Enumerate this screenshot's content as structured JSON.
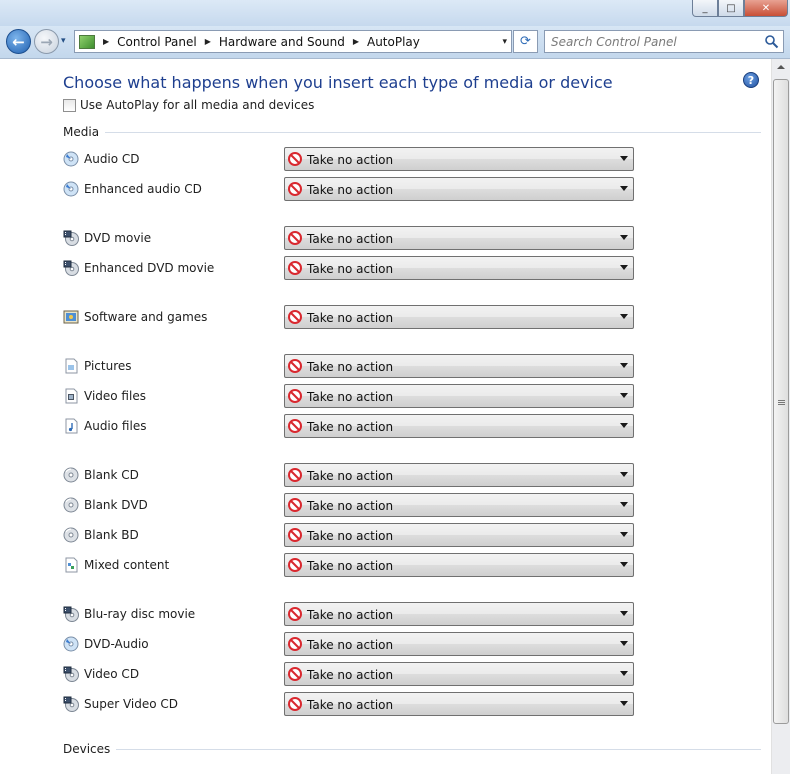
{
  "window": {
    "minimize_glyph": "_",
    "maximize_glyph": "□",
    "close_glyph": "✕"
  },
  "nav": {
    "back_glyph": "←",
    "forward_glyph": "→",
    "recent_glyph": "▾",
    "breadcrumbs": [
      "Control Panel",
      "Hardware and Sound",
      "AutoPlay"
    ],
    "dropdown_glyph": "▾",
    "refresh_glyph": "⟳",
    "search_placeholder": "Search Control Panel"
  },
  "page": {
    "title": "Choose what happens when you insert each type of media or device",
    "help_glyph": "?",
    "use_autoplay_label": "Use AutoPlay for all media and devices",
    "use_autoplay_checked": false,
    "media_section": "Media",
    "devices_section": "Devices"
  },
  "media": [
    {
      "label": "Audio CD",
      "icon": "audio-cd-icon",
      "action": "Take no action"
    },
    {
      "label": "Enhanced audio CD",
      "icon": "audio-cd-icon",
      "action": "Take no action"
    },
    {
      "label": "DVD movie",
      "icon": "dvd-movie-icon",
      "action": "Take no action"
    },
    {
      "label": "Enhanced DVD movie",
      "icon": "dvd-movie-icon",
      "action": "Take no action"
    },
    {
      "label": "Software and games",
      "icon": "software-icon",
      "action": "Take no action"
    },
    {
      "label": "Pictures",
      "icon": "pictures-icon",
      "action": "Take no action"
    },
    {
      "label": "Video files",
      "icon": "video-files-icon",
      "action": "Take no action"
    },
    {
      "label": "Audio files",
      "icon": "audio-files-icon",
      "action": "Take no action"
    },
    {
      "label": "Blank CD",
      "icon": "blank-disc-icon",
      "action": "Take no action"
    },
    {
      "label": "Blank DVD",
      "icon": "blank-disc-icon",
      "action": "Take no action"
    },
    {
      "label": "Blank BD",
      "icon": "blank-disc-icon",
      "action": "Take no action"
    },
    {
      "label": "Mixed content",
      "icon": "mixed-content-icon",
      "action": "Take no action"
    },
    {
      "label": "Blu-ray disc movie",
      "icon": "dvd-movie-icon",
      "action": "Take no action"
    },
    {
      "label": "DVD-Audio",
      "icon": "audio-cd-icon",
      "action": "Take no action"
    },
    {
      "label": "Video CD",
      "icon": "dvd-movie-icon",
      "action": "Take no action"
    },
    {
      "label": "Super Video CD",
      "icon": "dvd-movie-icon",
      "action": "Take no action"
    }
  ],
  "colors": {
    "title_blue": "#1e3f8f",
    "no_action_red": "#d9282f"
  }
}
